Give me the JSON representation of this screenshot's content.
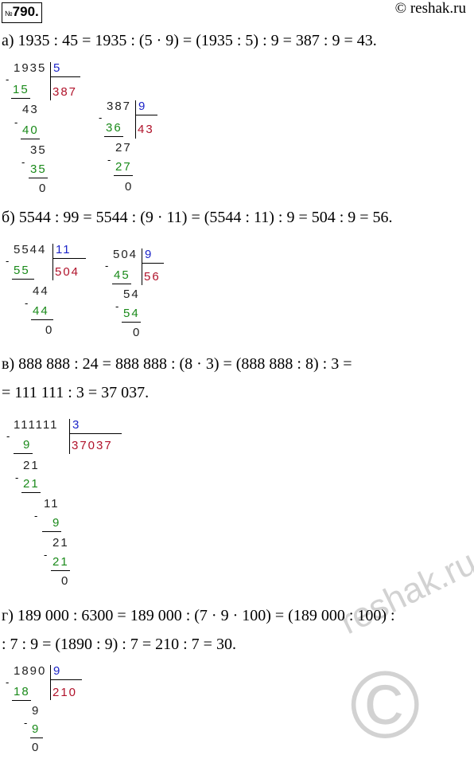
{
  "header": {
    "number_prefix": "№",
    "number": "790.",
    "site": "© reshak.ru"
  },
  "watermark": {
    "text": "reshak.ru",
    "symbol": "©"
  },
  "sections": {
    "a": {
      "line1": "а) 1935 : 45 = 1935 : (5 · 9) = (1935 : 5) : 9 = 387 : 9 = 43.",
      "div1": {
        "dividend": "1935",
        "divisor": "5",
        "quotient": "387",
        "steps": [
          "15",
          "43",
          "40",
          "35",
          "35",
          "0"
        ]
      },
      "div2": {
        "dividend": "387",
        "divisor": "9",
        "quotient": "43",
        "steps": [
          "36",
          "27",
          "27",
          "0"
        ]
      }
    },
    "b": {
      "line1": "б) 5544 : 99 = 5544 : (9 · 11) = (5544 : 11) : 9 = 504 : 9 = 56.",
      "div1": {
        "dividend": "5544",
        "divisor": "11",
        "quotient": "504",
        "steps": [
          "55",
          "44",
          "44",
          "0"
        ]
      },
      "div2": {
        "dividend": "504",
        "divisor": "9",
        "quotient": "56",
        "steps": [
          "45",
          "54",
          "54",
          "0"
        ]
      }
    },
    "c": {
      "line1": "в) 888 888 : 24 = 888 888 : (8 · 3) = (888 888 : 8) : 3 =",
      "line2": "= 111 111 : 3 = 37 037.",
      "div1": {
        "dividend": "111111",
        "divisor": "3",
        "quotient": "37037",
        "steps": [
          "9",
          "21",
          "21",
          "11",
          "9",
          "21",
          "21",
          "0"
        ]
      }
    },
    "d": {
      "line1": "г) 189 000 : 6300 = 189 000 : (7 · 9 · 100) = (189 000 : 100) :",
      "line2": ": 7 : 9 = (1890 : 9) : 7 = 210 : 7 = 30.",
      "div1": {
        "dividend": "1890",
        "divisor": "9",
        "quotient": "210",
        "steps": [
          "18",
          "9",
          "9",
          "0"
        ]
      }
    }
  }
}
